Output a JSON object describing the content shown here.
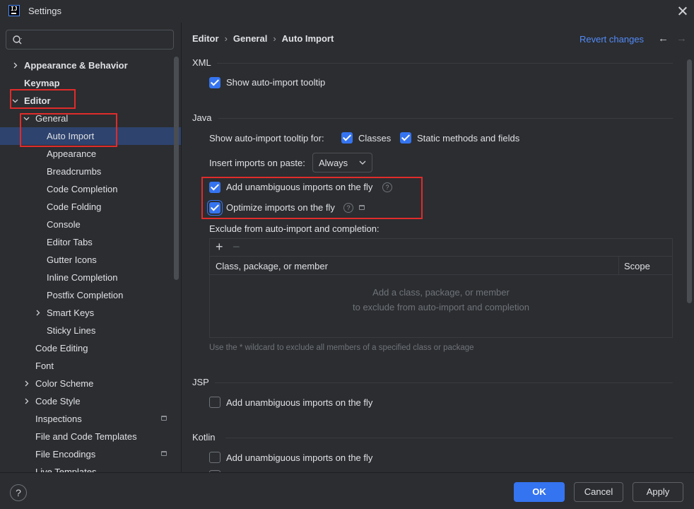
{
  "window": {
    "title": "Settings",
    "close_icon": "close-icon",
    "app_icon": "intellij-icon"
  },
  "sidebar": {
    "search_placeholder": "",
    "items": [
      {
        "label": "Appearance & Behavior",
        "level": 0,
        "bold": true,
        "expandable": true,
        "expanded": false
      },
      {
        "label": "Keymap",
        "level": 0,
        "bold": true,
        "expandable": false
      },
      {
        "label": "Editor",
        "level": 0,
        "bold": true,
        "expandable": true,
        "expanded": true
      },
      {
        "label": "General",
        "level": 1,
        "bold": false,
        "expandable": true,
        "expanded": true
      },
      {
        "label": "Auto Import",
        "level": 2,
        "bold": false,
        "expandable": false,
        "selected": true
      },
      {
        "label": "Appearance",
        "level": 2,
        "bold": false,
        "expandable": false
      },
      {
        "label": "Breadcrumbs",
        "level": 2,
        "bold": false,
        "expandable": false
      },
      {
        "label": "Code Completion",
        "level": 2,
        "bold": false,
        "expandable": false
      },
      {
        "label": "Code Folding",
        "level": 2,
        "bold": false,
        "expandable": false
      },
      {
        "label": "Console",
        "level": 2,
        "bold": false,
        "expandable": false
      },
      {
        "label": "Editor Tabs",
        "level": 2,
        "bold": false,
        "expandable": false
      },
      {
        "label": "Gutter Icons",
        "level": 2,
        "bold": false,
        "expandable": false
      },
      {
        "label": "Inline Completion",
        "level": 2,
        "bold": false,
        "expandable": false
      },
      {
        "label": "Postfix Completion",
        "level": 2,
        "bold": false,
        "expandable": false
      },
      {
        "label": "Smart Keys",
        "level": 2,
        "bold": false,
        "expandable": true,
        "expanded": false
      },
      {
        "label": "Sticky Lines",
        "level": 2,
        "bold": false,
        "expandable": false
      },
      {
        "label": "Code Editing",
        "level": 1,
        "bold": false,
        "expandable": false
      },
      {
        "label": "Font",
        "level": 1,
        "bold": false,
        "expandable": false
      },
      {
        "label": "Color Scheme",
        "level": 1,
        "bold": false,
        "expandable": true,
        "expanded": false
      },
      {
        "label": "Code Style",
        "level": 1,
        "bold": false,
        "expandable": true,
        "expanded": false
      },
      {
        "label": "Inspections",
        "level": 1,
        "bold": false,
        "expandable": false,
        "badge": true
      },
      {
        "label": "File and Code Templates",
        "level": 1,
        "bold": false,
        "expandable": false
      },
      {
        "label": "File Encodings",
        "level": 1,
        "bold": false,
        "expandable": false,
        "badge": true
      },
      {
        "label": "Live Templates",
        "level": 1,
        "bold": false,
        "expandable": false
      }
    ]
  },
  "breadcrumb": {
    "parts": [
      "Editor",
      "General",
      "Auto Import"
    ],
    "separator": "›"
  },
  "header": {
    "revert_label": "Revert changes",
    "back_icon": "arrow-left-icon",
    "forward_icon": "arrow-right-icon"
  },
  "xml": {
    "title": "XML",
    "show_tooltip": {
      "label": "Show auto-import tooltip",
      "checked": true
    }
  },
  "java": {
    "title": "Java",
    "tooltip_for_label": "Show auto-import tooltip for:",
    "classes": {
      "label": "Classes",
      "checked": true
    },
    "static_methods": {
      "label": "Static methods and fields",
      "checked": true
    },
    "insert_on_paste_label": "Insert imports on paste:",
    "insert_on_paste_value": "Always",
    "add_unambiguous": {
      "label": "Add unambiguous imports on the fly",
      "checked": true
    },
    "optimize_imports": {
      "label": "Optimize imports on the fly",
      "checked": true
    },
    "exclude_label": "Exclude from auto-import and completion:",
    "table": {
      "columns": [
        "Class, package, or member",
        "Scope"
      ],
      "empty_line1": "Add a class, package, or member",
      "empty_line2": "to exclude from auto-import and completion",
      "add_icon": "plus-icon",
      "remove_icon": "minus-icon"
    },
    "hint": "Use the * wildcard to exclude all members of a specified class or package"
  },
  "jsp": {
    "title": "JSP",
    "add_unambiguous": {
      "label": "Add unambiguous imports on the fly",
      "checked": false
    }
  },
  "kotlin": {
    "title": "Kotlin",
    "add_unambiguous": {
      "label": "Add unambiguous imports on the fly",
      "checked": false
    }
  },
  "footer": {
    "ok_label": "OK",
    "cancel_label": "Cancel",
    "apply_label": "Apply",
    "help_icon": "help-icon"
  },
  "colors": {
    "accent": "#3574f0",
    "selection": "#2e436e",
    "highlight_box": "#e02b2b",
    "link": "#548af7"
  }
}
